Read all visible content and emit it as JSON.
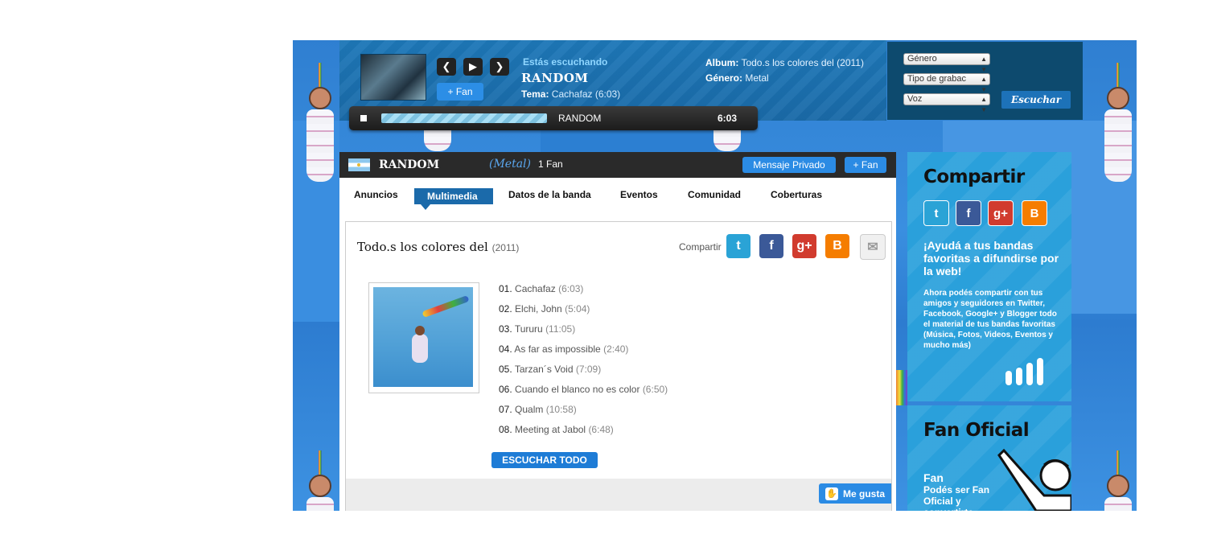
{
  "player": {
    "listening_label": "Estás escuchando",
    "band": "RANDOM",
    "fan_label": "+ Fan",
    "tema_label": "Tema:",
    "tema_value": "Cachafaz (6:03)",
    "album_label": "Album:",
    "album_value": "Todo.s los colores del (2011)",
    "genre_label": "Género:",
    "genre_value": "Metal",
    "now_playing": "RANDOM",
    "time": "6:03",
    "progress": 1.0,
    "icons": [
      "prev-icon",
      "play-icon",
      "next-icon",
      "stop-icon"
    ]
  },
  "search": {
    "genre": "Género",
    "recording_type": "Tipo de grabac",
    "voice": "Voz",
    "button": "Escuchar"
  },
  "band_bar": {
    "name": "RANDOM",
    "genre": "(Metal)",
    "fans": "1 Fan",
    "message_button": "Mensaje Privado",
    "fan_button": "+ Fan"
  },
  "tabs": [
    {
      "label": "Anuncios"
    },
    {
      "label": "Multimedia",
      "active": true
    },
    {
      "label": "Datos de la banda"
    },
    {
      "label": "Eventos"
    },
    {
      "label": "Comunidad"
    },
    {
      "label": "Coberturas"
    }
  ],
  "album": {
    "title": "Todo.s los colores del",
    "year": "(2011)",
    "share_label": "Compartir",
    "share_icons": [
      "twitter-icon",
      "facebook-icon",
      "google-plus-icon",
      "blogger-icon",
      "email-icon"
    ],
    "tracks": [
      {
        "num": "01.",
        "name": "Cachafaz",
        "dur": "(6:03)"
      },
      {
        "num": "02.",
        "name": "Elchi, John",
        "dur": "(5:04)"
      },
      {
        "num": "03.",
        "name": "Tururu",
        "dur": "(11:05)"
      },
      {
        "num": "04.",
        "name": "As far as impossible",
        "dur": "(2:40)"
      },
      {
        "num": "05.",
        "name": "Tarzan´s Void",
        "dur": "(7:09)"
      },
      {
        "num": "06.",
        "name": "Cuando el blanco no es color",
        "dur": "(6:50)"
      },
      {
        "num": "07.",
        "name": "Qualm",
        "dur": "(10:58)"
      },
      {
        "num": "08.",
        "name": "Meeting at Jabol",
        "dur": "(6:48)"
      }
    ],
    "listen_all": "ESCUCHAR TODO",
    "like": "Me gusta"
  },
  "sidebar": {
    "share_title": "Compartir",
    "share_lead": "¡Ayudá a tus bandas favoritas a difundirse por la web!",
    "share_body": "Ahora podés compartir con tus amigos y seguidores en Twitter, Facebook, Google+ y Blogger todo el material de tus bandas favoritas (Música, Fotos, Videos, Eventos y mucho más)",
    "fan_title": "Fan Oficial",
    "fan_sub": "Fan",
    "fan_body": "Podés ser Fan Oficial y convertirte"
  },
  "colors": {
    "accent": "#2b8be4",
    "dark_bar": "#2a2a2a",
    "active_tab": "#1b6aaa",
    "sidebar": "#2aa0db",
    "twitter": "#2aa3d6",
    "facebook": "#3b5998",
    "google": "#d13b2e",
    "blogger": "#f57d00"
  }
}
